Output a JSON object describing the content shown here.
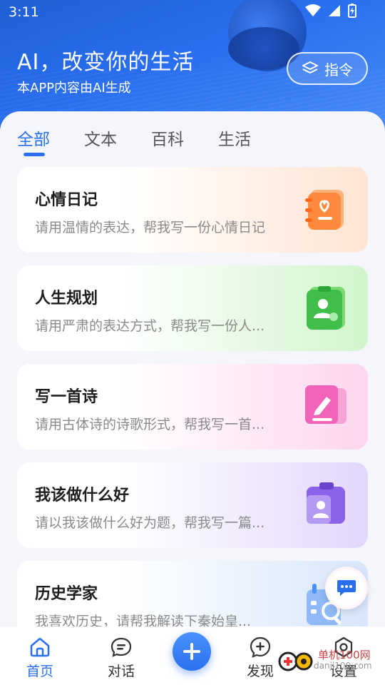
{
  "status_bar": {
    "time": "3:11"
  },
  "header": {
    "title": "AI，改变你的生活",
    "subtitle": "本APP内容由AI生成",
    "command_button": "指令"
  },
  "tabs": [
    "全部",
    "文本",
    "百科",
    "生活"
  ],
  "cards": [
    {
      "title": "心情日记",
      "desc": "请用温情的表达，帮我写一份心情日记",
      "icon": "diary-heart-icon",
      "color": "#ff8a3d"
    },
    {
      "title": "人生规划",
      "desc": "请用严肃的表达方式，帮我写一份人...",
      "icon": "person-plan-icon",
      "color": "#3fbf4a"
    },
    {
      "title": "写一首诗",
      "desc": "请用古体诗的诗歌形式，帮我写一首...",
      "icon": "pen-poem-icon",
      "color": "#f063b8"
    },
    {
      "title": "我该做什么好",
      "desc": "请以我该做什么好为题，帮我写一篇...",
      "icon": "person-task-icon",
      "color": "#8a63e8"
    },
    {
      "title": "历史学家",
      "desc": "我喜欢历史，请帮我解读下秦始皇...",
      "icon": "calendar-search-icon",
      "color": "#4a8ff7"
    }
  ],
  "bottom_nav": {
    "home": "首页",
    "chat": "对话",
    "discover": "发现",
    "settings": "设置"
  },
  "watermark": {
    "line1": "单机100网",
    "line2": "danji100.com"
  },
  "colors": {
    "accent": "#2a6ff0"
  }
}
